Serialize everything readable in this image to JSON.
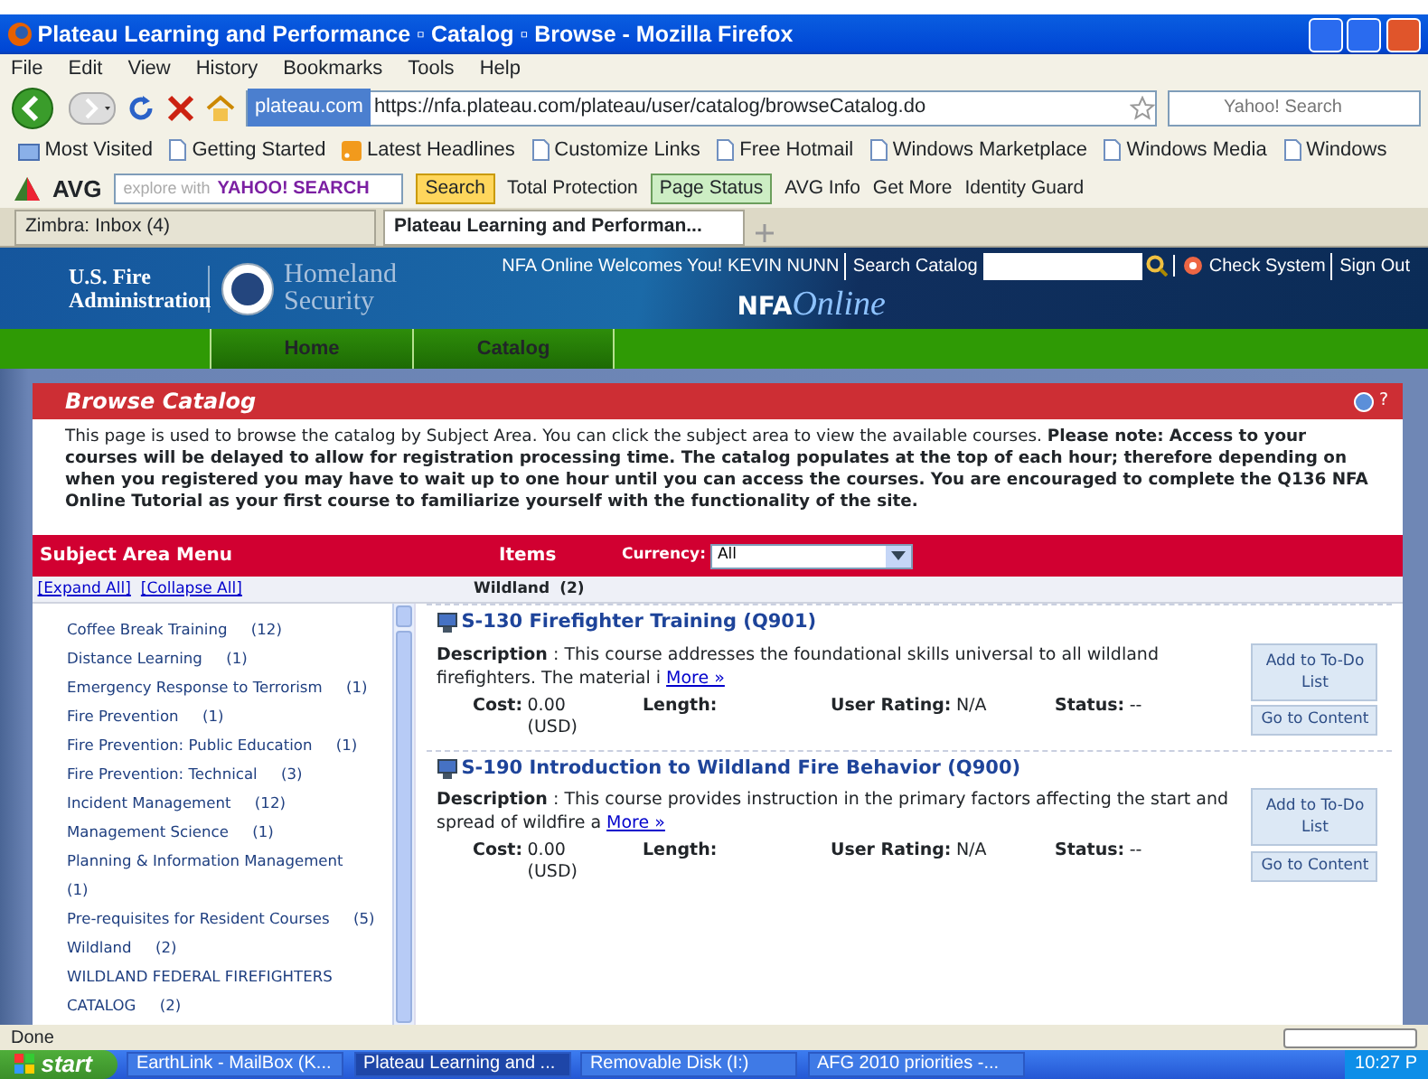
{
  "window": {
    "title": "Plateau Learning and Performance ▫ Catalog ▫ Browse - Mozilla Firefox"
  },
  "menu": [
    "File",
    "Edit",
    "View",
    "History",
    "Bookmarks",
    "Tools",
    "Help"
  ],
  "navbar": {
    "site_chip": "plateau.com",
    "url": "https://nfa.plateau.com/plateau/user/catalog/browseCatalog.do",
    "search_placeholder": "Yahoo! Search"
  },
  "bookmarks": [
    {
      "label": "Most Visited",
      "kind": "folder"
    },
    {
      "label": "Getting Started",
      "kind": "page"
    },
    {
      "label": "Latest Headlines",
      "kind": "feed"
    },
    {
      "label": "Customize Links",
      "kind": "page"
    },
    {
      "label": "Free Hotmail",
      "kind": "page"
    },
    {
      "label": "Windows Marketplace",
      "kind": "page"
    },
    {
      "label": "Windows Media",
      "kind": "page"
    },
    {
      "label": "Windows",
      "kind": "page"
    }
  ],
  "avg_toolbar": {
    "logo": "AVG",
    "search_hint": "explore with",
    "search_brand": "YAHOO! SEARCH",
    "search_button": "Search",
    "items": [
      {
        "label": "Total Protection",
        "active": false
      },
      {
        "label": "Page Status",
        "active": true
      },
      {
        "label": "AVG Info",
        "active": false
      },
      {
        "label": "Get More",
        "active": false
      },
      {
        "label": "Identity Guard",
        "active": false
      }
    ]
  },
  "tabs": [
    {
      "label": "Zimbra: Inbox (4)",
      "selected": false
    },
    {
      "label": "Plateau Learning and Performan...",
      "selected": true
    }
  ],
  "site_header": {
    "agency": "U.S. Fire Administration",
    "department": "Homeland Security",
    "welcome": "NFA Online Welcomes You! KEVIN NUNN",
    "search_label": "Search Catalog",
    "check_system": "Check System",
    "sign_out": "Sign Out",
    "logo_bold": "NFA",
    "logo_script": "Online"
  },
  "site_nav": [
    {
      "label": "Home"
    },
    {
      "label": "Catalog"
    }
  ],
  "panel": {
    "title": "Browse Catalog",
    "help": "?",
    "intro": "This page is used to browse the catalog by Subject Area. You can click the subject area to view the available courses. **Please note: Access to your courses will be delayed to allow for registration processing time. The catalog populates at the top of each hour; therefore depending on when you registered you may have to wait up to one hour until you can access the courses. You are encouraged to complete the Q136 NFA Online Tutorial as your first course to familiarize yourself with the functionality of the site.**"
  },
  "subject_menu": {
    "title": "Subject Area Menu",
    "expand_all": "[Expand All]",
    "collapse_all": "[Collapse All]",
    "subjects": [
      {
        "name": "Coffee Break Training",
        "count": "(12)"
      },
      {
        "name": "Distance Learning",
        "count": "(1)"
      },
      {
        "name": "Emergency Response to Terrorism",
        "count": "(1)"
      },
      {
        "name": "Fire Prevention",
        "count": "(1)"
      },
      {
        "name": "Fire Prevention: Public Education",
        "count": "(1)"
      },
      {
        "name": "Fire Prevention: Technical",
        "count": "(3)"
      },
      {
        "name": "Incident Management",
        "count": "(12)"
      },
      {
        "name": "Management Science",
        "count": "(1)"
      },
      {
        "name": "Planning & Information Management",
        "count": "(1)"
      },
      {
        "name": "Pre-requisites for Resident Courses",
        "count": "(5)"
      },
      {
        "name": "Wildland",
        "count": "(2)"
      },
      {
        "name": "WILDLAND FEDERAL FIREFIGHTERS CATALOG",
        "count": "(2)"
      }
    ]
  },
  "items": {
    "title": "Items",
    "currency_label": "Currency:",
    "currency_value": "All",
    "subject": "Wildland",
    "subject_count": "(2)",
    "courses": [
      {
        "title": "S-130 Firefighter Training (Q901)",
        "description_label": "Description",
        "description": " : This course addresses the foundational skills universal to all wildland firefighters. The material i",
        "more": "More »",
        "cost_label": "Cost:",
        "cost": "0.00 (USD)",
        "length_label": "Length:",
        "rating_label": "User Rating:",
        "rating": "N/A",
        "status_label": "Status:",
        "status": "--",
        "todo_button": "Add to To-Do List",
        "content_button": "Go to Content"
      },
      {
        "title": "S-190 Introduction to Wildland Fire Behavior (Q900)",
        "description_label": "Description",
        "description": " : This course provides instruction in the primary factors affecting the start and spread of wildfire a",
        "more": "More »",
        "cost_label": "Cost:",
        "cost": "0.00 (USD)",
        "length_label": "Length:",
        "rating_label": "User Rating:",
        "rating": "N/A",
        "status_label": "Status:",
        "status": "--",
        "todo_button": "Add to To-Do List",
        "content_button": "Go to Content"
      }
    ]
  },
  "status_bar": {
    "text": "Done"
  },
  "taskbar": {
    "start": "start",
    "tasks": [
      {
        "label": "EarthLink - MailBox (K...",
        "selected": false
      },
      {
        "label": "Plateau Learning and ...",
        "selected": true
      },
      {
        "label": "Removable Disk (I:)",
        "selected": false
      },
      {
        "label": "AFG 2010 priorities -...",
        "selected": false
      }
    ],
    "clock": "10:27 P"
  }
}
